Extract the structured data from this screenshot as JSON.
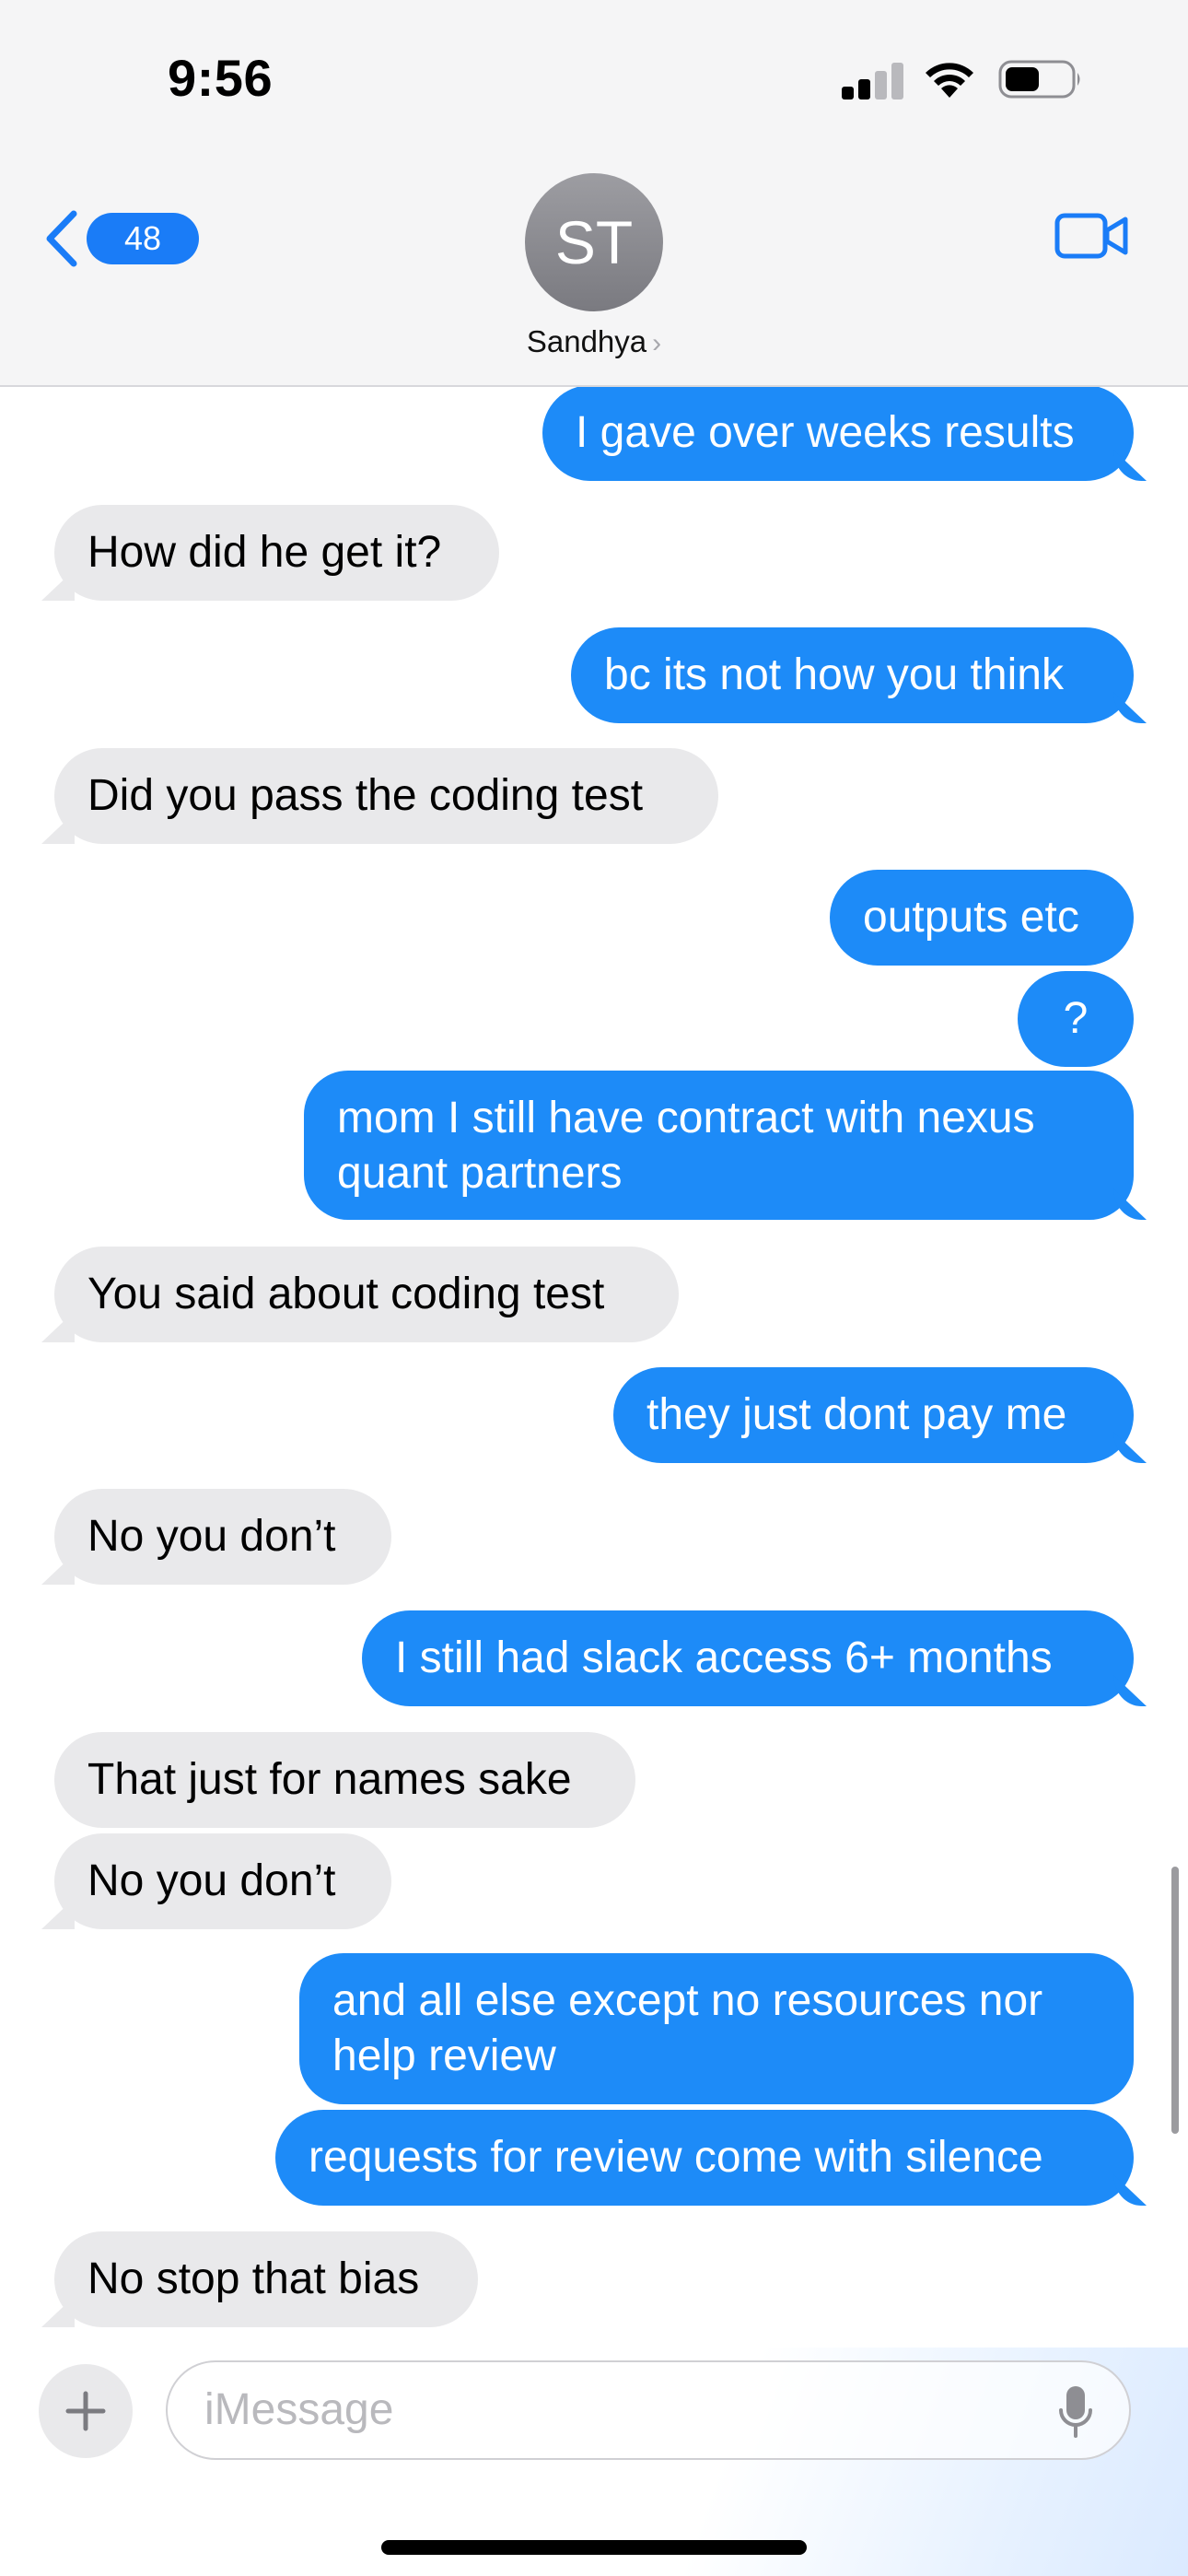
{
  "status_bar": {
    "time": "9:56"
  },
  "header": {
    "back_count": "48",
    "avatar_initials": "ST",
    "contact_name": "Sandhya",
    "name_chevron": "›",
    "icons": {
      "back": "chevron-left-icon",
      "video": "video-camera-icon"
    }
  },
  "messages": [
    {
      "dir": "sent",
      "text": "I gave over weeks results"
    },
    {
      "dir": "recv",
      "text": "How did he get it?"
    },
    {
      "dir": "sent",
      "text": "bc its not how you think"
    },
    {
      "dir": "recv",
      "text": "Did you pass the coding test"
    },
    {
      "dir": "sent",
      "text": "outputs etc"
    },
    {
      "dir": "sent",
      "text": "?"
    },
    {
      "dir": "sent",
      "text": "mom I still have contract with nexus quant partners"
    },
    {
      "dir": "recv",
      "text": "You said about coding test"
    },
    {
      "dir": "sent",
      "text": "they just dont pay me"
    },
    {
      "dir": "recv",
      "text": "No you don’t"
    },
    {
      "dir": "sent",
      "text": "I still had slack access 6+ months"
    },
    {
      "dir": "recv",
      "text": "That just for names sake"
    },
    {
      "dir": "recv",
      "text": "No you don’t"
    },
    {
      "dir": "sent",
      "text": "and all else except no resources nor help review"
    },
    {
      "dir": "sent",
      "text": "requests for review come with silence"
    },
    {
      "dir": "recv",
      "text": "No stop that bias"
    }
  ],
  "composer": {
    "placeholder": "iMessage",
    "plus_label": "+",
    "icons": {
      "plus": "plus-icon",
      "mic": "microphone-icon"
    }
  },
  "colors": {
    "sent_bubble": "#1d8bf8",
    "recv_bubble": "#e9e9eb",
    "accent": "#1a7cf7"
  }
}
